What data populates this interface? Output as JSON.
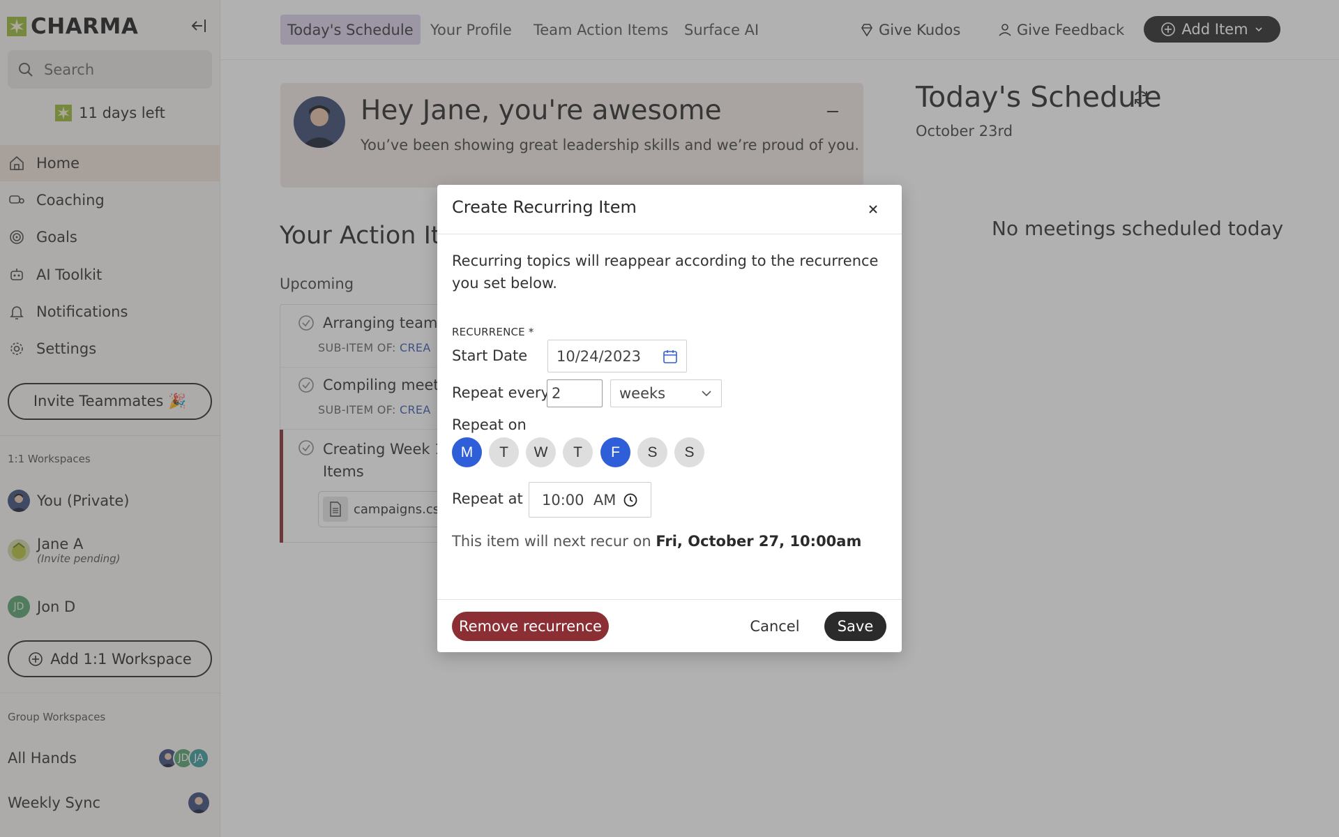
{
  "app": {
    "name": "CHARMA",
    "colors": {
      "brand_mark": "#9ab83a",
      "dark": "#2b2b2b",
      "accent_blue": "#2f5fd8",
      "danger": "#8c2f35",
      "active_nav": "#efe2d9",
      "active_tab": "#dcd0ea"
    }
  },
  "sidebar": {
    "search_placeholder": "Search",
    "trial_text": "11 days left",
    "nav": [
      {
        "label": "Home",
        "icon": "home-icon"
      },
      {
        "label": "Coaching",
        "icon": "coaching-icon"
      },
      {
        "label": "Goals",
        "icon": "goals-icon"
      },
      {
        "label": "AI Toolkit",
        "icon": "robot-icon"
      },
      {
        "label": "Notifications",
        "icon": "bell-icon"
      },
      {
        "label": "Settings",
        "icon": "gear-icon"
      }
    ],
    "invite_label": "Invite Teammates 🎉",
    "one_on_one_label": "1:1 Workspaces",
    "workspaces": [
      {
        "name": "You (Private)"
      },
      {
        "name": "Jane A",
        "sub": "(Invite pending)"
      },
      {
        "name": "Jon D",
        "initials": "JD"
      }
    ],
    "add_workspace_label": "Add 1:1 Workspace",
    "group_label": "Group Workspaces",
    "groups": [
      {
        "name": "All Hands",
        "avatars": [
          "",
          "JD",
          "JA"
        ]
      },
      {
        "name": "Weekly Sync"
      }
    ]
  },
  "topnav": {
    "tabs": [
      "Today's Schedule",
      "Your Profile",
      "Team Action Items",
      "Surface AI"
    ],
    "give_kudos": "Give Kudos",
    "give_feedback": "Give Feedback",
    "add_item": "Add Item"
  },
  "main": {
    "hey_title": "Hey Jane, you're awesome",
    "hey_sub": "You’ve been showing great leadership skills and we’re proud of you.",
    "action_title": "Your Action Item",
    "upcoming_label": "Upcoming",
    "items": [
      {
        "text": "Arranging team c",
        "sub_prefix": "SUB-ITEM OF:",
        "sub_link": "CREA"
      },
      {
        "text": "Compiling meetin",
        "sub_prefix": "SUB-ITEM OF:",
        "sub_link": "CREA"
      },
      {
        "text_line1": "Creating Week 1",
        "text_line2": "Items",
        "file": "campaigns.csv"
      }
    ]
  },
  "schedule": {
    "title": "Today's Schedule",
    "date": "October 23rd",
    "empty": "No meetings scheduled today"
  },
  "modal": {
    "title": "Create Recurring Item",
    "description": "Recurring topics will reappear according to the recurrence you set below.",
    "recurrence_label": "RECURRENCE *",
    "start_date_label": "Start Date",
    "start_date_value": "10/24/2023",
    "repeat_every_label": "Repeat every",
    "repeat_every_value": "2",
    "repeat_unit": "weeks",
    "repeat_on_label": "Repeat on",
    "days": [
      {
        "label": "M",
        "selected": true
      },
      {
        "label": "T",
        "selected": false
      },
      {
        "label": "W",
        "selected": false
      },
      {
        "label": "T",
        "selected": false
      },
      {
        "label": "F",
        "selected": true
      },
      {
        "label": "S",
        "selected": false
      },
      {
        "label": "S",
        "selected": false
      }
    ],
    "repeat_at_label": "Repeat at",
    "repeat_at_value": "10:00  AM",
    "next_recur_prefix": "This item will next recur on",
    "next_recur_value": "Fri, October 27, 10:00am",
    "remove_label": "Remove recurrence",
    "cancel_label": "Cancel",
    "save_label": "Save"
  }
}
